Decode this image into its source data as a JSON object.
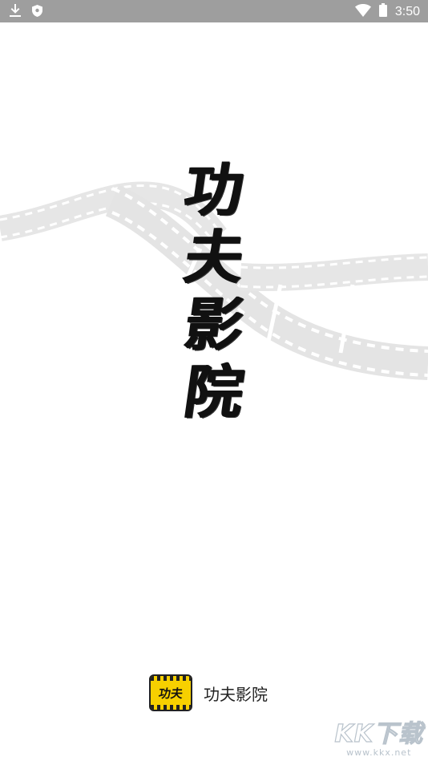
{
  "status_bar": {
    "time": "3:50",
    "left_icons": [
      "download-icon",
      "shield-icon"
    ],
    "right_icons": [
      "wifi-icon",
      "battery-icon"
    ],
    "color": "#9e9e9e"
  },
  "splash": {
    "title_chars": [
      "功",
      "夫",
      "影",
      "院"
    ],
    "background_art": "film-strip"
  },
  "brand": {
    "logo_text": "功夫",
    "name": "功夫影院",
    "logo_color": "#f7d000"
  },
  "watermark": {
    "big": "KK下载",
    "small": "www.kkx.net"
  }
}
